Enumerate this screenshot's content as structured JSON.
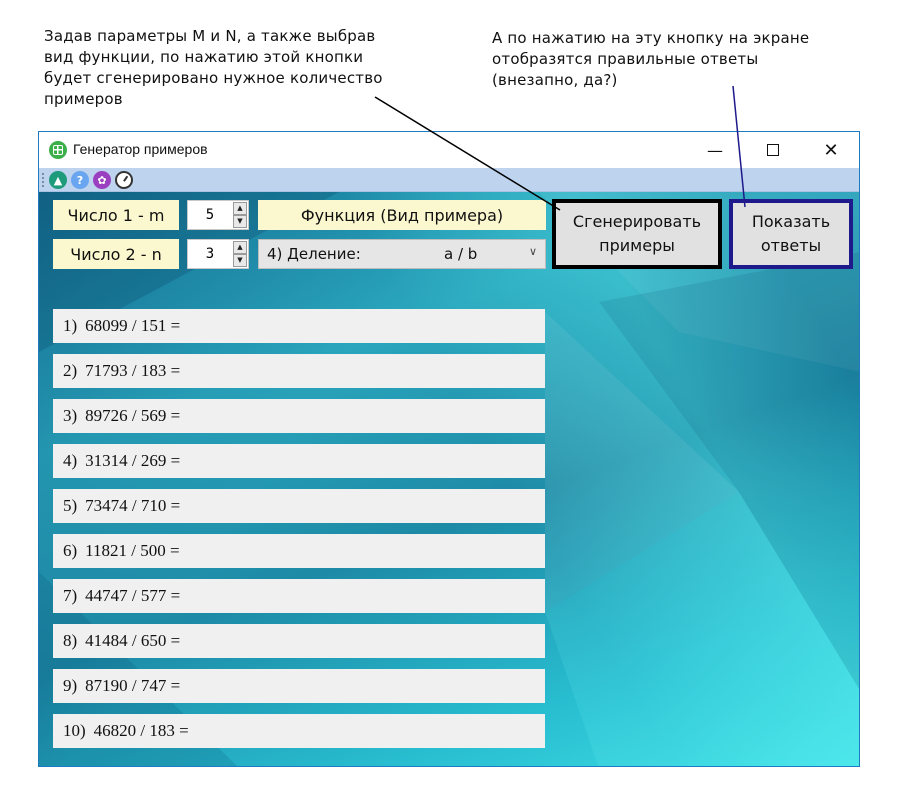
{
  "annotations": {
    "left_lines": [
      "Задав параметры M и N, а также выбрав",
      "вид функции, по нажатию этой кнопки",
      "будет сгенерировано нужное количество",
      "примеров"
    ],
    "right_lines": [
      "А по нажатию на эту кнопку на экране",
      "отобразятся правильные ответы",
      "(внезапно, да?)"
    ]
  },
  "window": {
    "title": "Генератор примеров",
    "controls": {
      "minimize": "—",
      "maximize": "",
      "close": "✕"
    }
  },
  "toolbar": {
    "icons": [
      "warning-icon",
      "help-icon",
      "settings-icon",
      "stopwatch-icon"
    ],
    "help_glyph": "?",
    "warning_glyph": "▲",
    "settings_glyph": "✿"
  },
  "params": {
    "m_label": "Число 1 - m",
    "m_value": "5",
    "n_label": "Число 2 - n",
    "n_value": "3",
    "func_label": "Функция (Вид примера)",
    "func_selected": "4) Деление:",
    "func_formula": "a / b"
  },
  "buttons": {
    "generate": "Сгенерировать примеры",
    "answers": "Показать ответы"
  },
  "examples": [
    {
      "num": "1)",
      "expr": "68099 / 151 ="
    },
    {
      "num": "2)",
      "expr": "71793 / 183 ="
    },
    {
      "num": "3)",
      "expr": "89726 / 569 ="
    },
    {
      "num": "4)",
      "expr": "31314 / 269 ="
    },
    {
      "num": "5)",
      "expr": "73474 / 710 ="
    },
    {
      "num": "6)",
      "expr": "11821 / 500 ="
    },
    {
      "num": "7)",
      "expr": "44747 / 577 ="
    },
    {
      "num": "8)",
      "expr": "41484 / 650 ="
    },
    {
      "num": "9)",
      "expr": "87190 / 747 ="
    },
    {
      "num": "10)",
      "expr": "46820 / 183 ="
    }
  ],
  "colors": {
    "label_bg": "#fbf8cf",
    "generate_border": "#000000",
    "answers_border": "#1e1a8c",
    "row_bg": "#f0f0f0",
    "toolbar_bg": "#bdd3ee"
  }
}
